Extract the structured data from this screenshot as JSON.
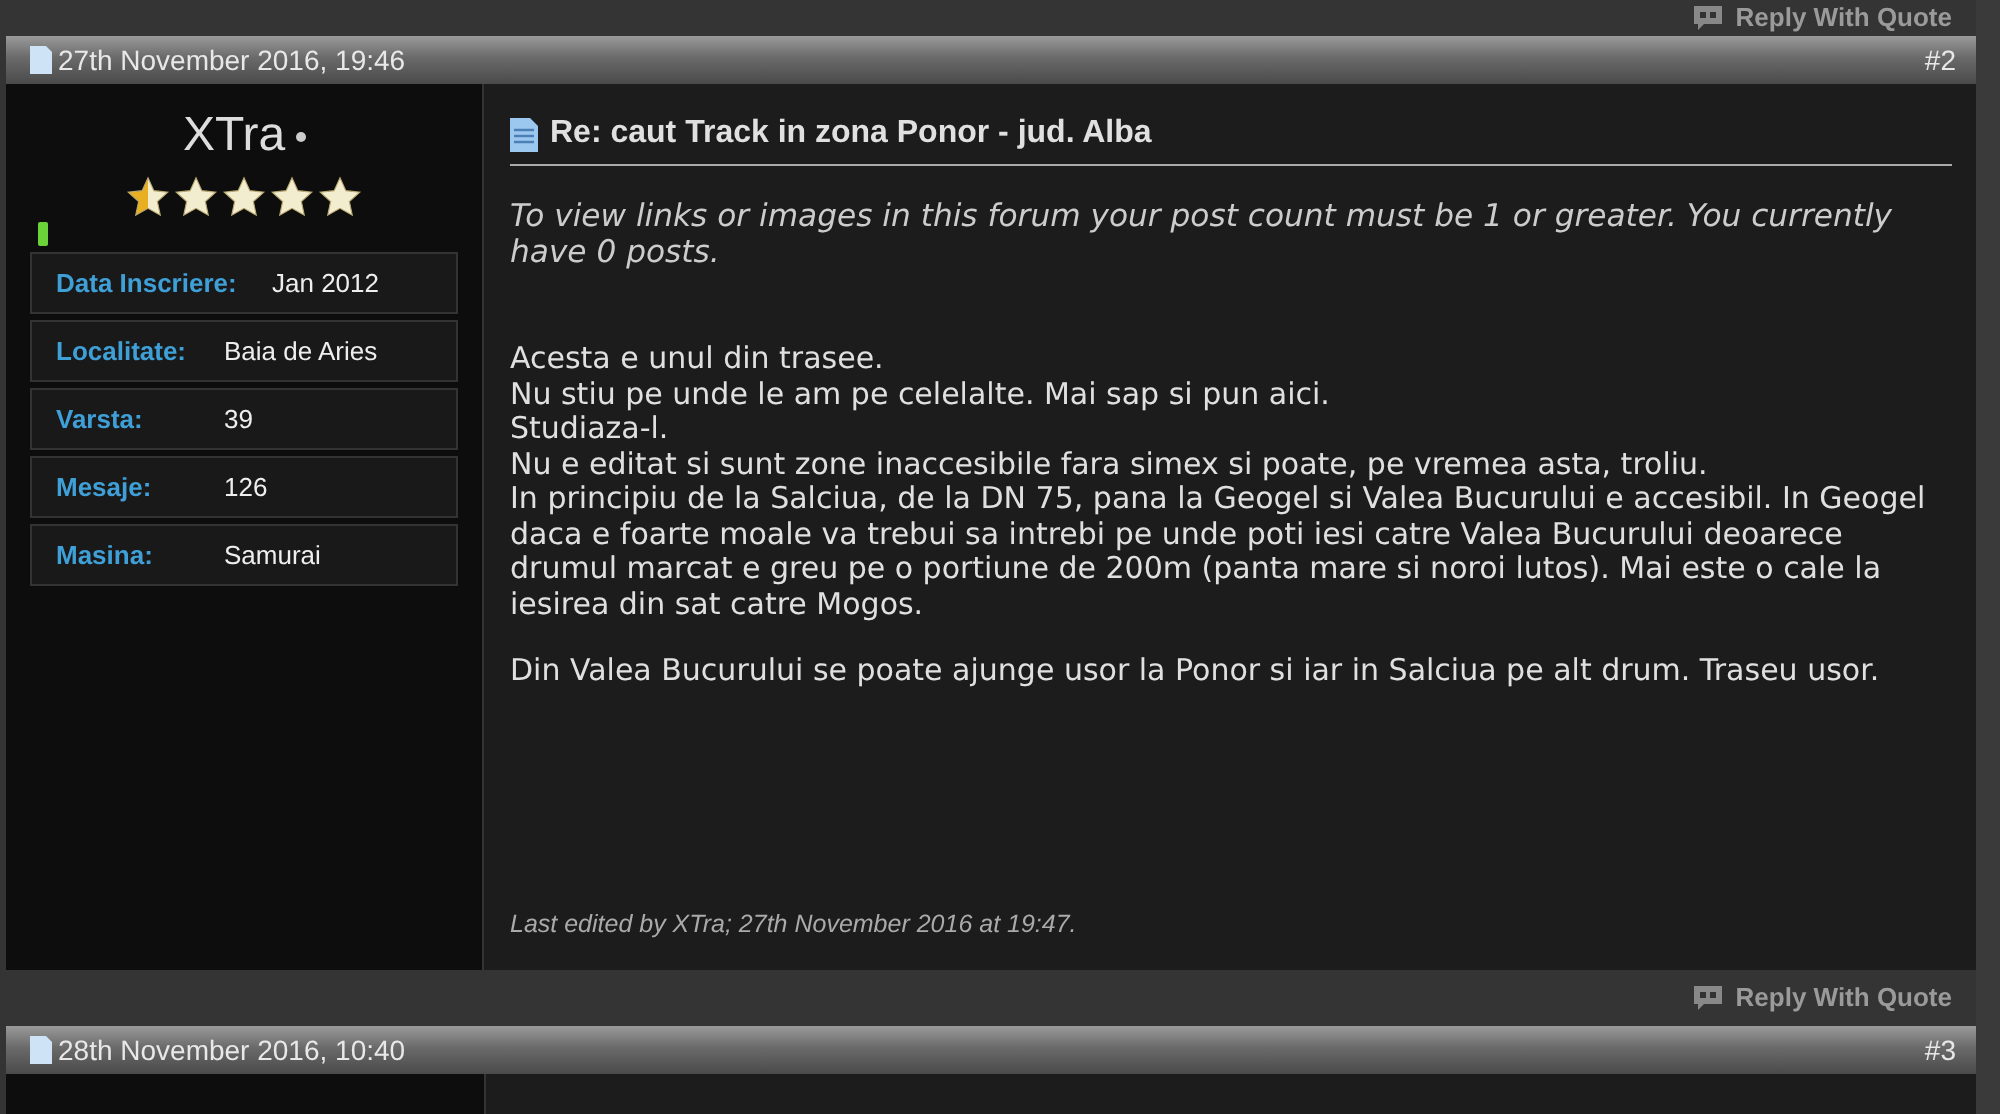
{
  "top_bar": {
    "reply_button": "Reply With Quote"
  },
  "posts": [
    {
      "date": "27th November 2016, 19:46",
      "number": "#2",
      "author": {
        "name": "XTra",
        "stars": 0.5,
        "online": true,
        "details": [
          {
            "label": "Data Inscriere:",
            "value": "Jan 2012"
          },
          {
            "label": "Localitate:",
            "value": "Baia de Aries"
          },
          {
            "label": "Varsta:",
            "value": "39"
          },
          {
            "label": "Mesaje:",
            "value": "126"
          },
          {
            "label": "Masina:",
            "value": "Samurai"
          }
        ]
      },
      "title": "Re: caut Track in zona Ponor - jud. Alba",
      "notice": "To view links or images in this forum your post count must be 1 or greater. You currently have 0 posts.",
      "paragraphs": [
        [
          "Acesta e unul din trasee.",
          "Nu stiu pe unde le am pe celelalte. Mai sap si pun aici.",
          "Studiaza-l.",
          "Nu e editat si sunt zone inaccesibile fara simex si poate, pe vremea asta, troliu.",
          "In principiu de la Salciua, de la DN 75, pana la Geogel si Valea Bucurului e accesibil. In Geogel daca e foarte moale va trebui sa intrebi pe unde poti iesi catre Valea Bucurului deoarece drumul marcat e greu pe o portiune de 200m (panta mare si noroi lutos). Mai este o cale la iesirea din sat catre Mogos."
        ],
        [
          "Din Valea Bucurului se poate ajunge usor la Ponor si iar in Salciua pe alt drum. Traseu usor."
        ]
      ],
      "edited": "Last edited by XTra; 27th November 2016 at 19:47.",
      "reply_button": "Reply With Quote"
    },
    {
      "date": "28th November 2016, 10:40",
      "number": "#3"
    }
  ]
}
